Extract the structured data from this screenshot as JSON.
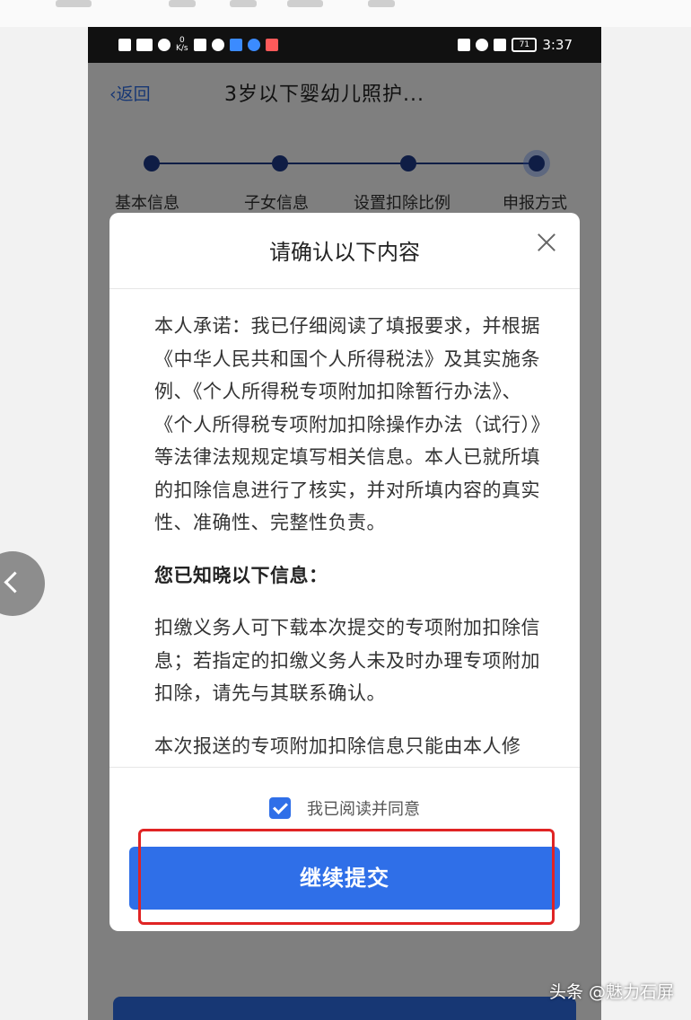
{
  "status_bar": {
    "net_speed_value": "0",
    "net_speed_unit": "K/s",
    "battery": "71",
    "time": "3:37"
  },
  "nav": {
    "back_label": "返回",
    "title": "3岁以下婴幼儿照护..."
  },
  "steps": {
    "items": [
      {
        "label": "基本信息"
      },
      {
        "label": "子女信息"
      },
      {
        "label": "设置扣除比例"
      },
      {
        "label": "申报方式"
      }
    ]
  },
  "dialog": {
    "title": "请确认以下内容",
    "paragraphs": [
      "本人承诺：我已仔细阅读了填报要求，并根据《中华人民共和国个人所得税法》及其实施条例、《个人所得税专项附加扣除暂行办法》、《个人所得税专项附加扣除操作办法（试行）》等法律法规规定填写相关信息。本人已就所填的扣除信息进行了核实，并对所填内容的真实性、准确性、完整性负责。",
      "您已知晓以下信息：",
      "扣缴义务人可下载本次提交的专项附加扣除信息；若指定的扣缴义务人未及时办理专项附加扣除，请先与其联系确认。",
      "本次报送的专项附加扣除信息只能由本人修"
    ],
    "agree_label": "我已阅读并同意",
    "submit_label": "继续提交"
  },
  "watermark": "头条 @魅力石屏",
  "colors": {
    "primary": "#2f6fe8",
    "highlight_frame": "#e02424",
    "step_dot": "#1e3a8a"
  }
}
